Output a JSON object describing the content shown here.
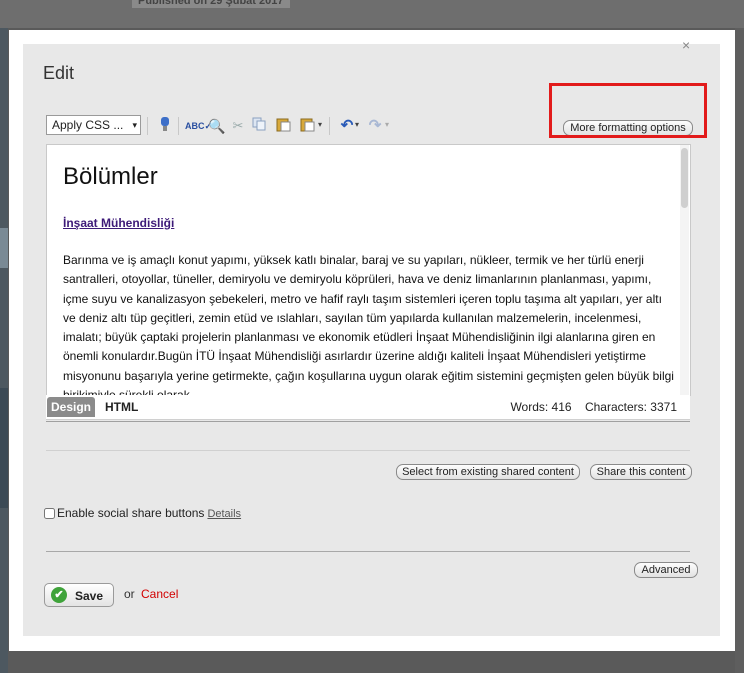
{
  "background": {
    "published_text": "Published on 29 Şubat 2017"
  },
  "dialog": {
    "title": "Edit",
    "close_icon": "×"
  },
  "toolbar": {
    "css_select_value": "Apply CSS ...",
    "icons": [
      "style-icon",
      "spellcheck-icon",
      "find-icon",
      "cut-icon",
      "copy-icon",
      "paste-icon",
      "paste-special-icon",
      "undo-icon",
      "redo-icon"
    ],
    "more_formatting_label": "More formatting options"
  },
  "editor": {
    "heading": "Bölümler",
    "link_text": "İnşaat Mühendisliği",
    "paragraph": "Barınma ve iş amaçlı konut yapımı, yüksek katlı binalar, baraj ve su yapıları, nükleer, termik ve her türlü enerji santralleri, otoyollar, tüneller, demiryolu ve demiryolu köprüleri, hava ve deniz limanlarının planlanması, yapımı, içme suyu ve kanalizasyon şebekeleri, metro ve hafif raylı taşım sistemleri içeren toplu taşıma alt yapıları, yer altı ve deniz altı tüp geçitleri, zemin etüd ve ıslahları, sayılan tüm yapılarda kullanılan malzemelerin, incelenmesi, imalatı; büyük çaptaki projelerin planlanması ve ekonomik etüdleri İnşaat Mühendisliğinin ilgi alanlarına giren en önemli konulardır.Bugün İTÜ İnşaat Mühendisliği asırlardır üzerine aldığı kaliteli İnşaat Mühendisleri yetiştirme misyonunu başarıyla yerine getirmekte, çağın koşullarına uygun olarak eğitim sistemini geçmişten gelen büyük bilgi birikimiyle sürekli olarak"
  },
  "tabs": {
    "design": "Design",
    "html": "HTML",
    "words": "Words: 416",
    "characters": "Characters: 3371"
  },
  "shared": {
    "select_existing": "Select from existing shared content",
    "share_this": "Share this content"
  },
  "social": {
    "label": "Enable social share buttons",
    "details": "Details"
  },
  "footer": {
    "advanced": "Advanced",
    "save": "Save",
    "or": "or",
    "cancel": "Cancel"
  },
  "colors": {
    "highlight": "#e21b1b",
    "cancel": "#d20000",
    "save_check": "#3fa33a",
    "link": "#3d1a78"
  }
}
